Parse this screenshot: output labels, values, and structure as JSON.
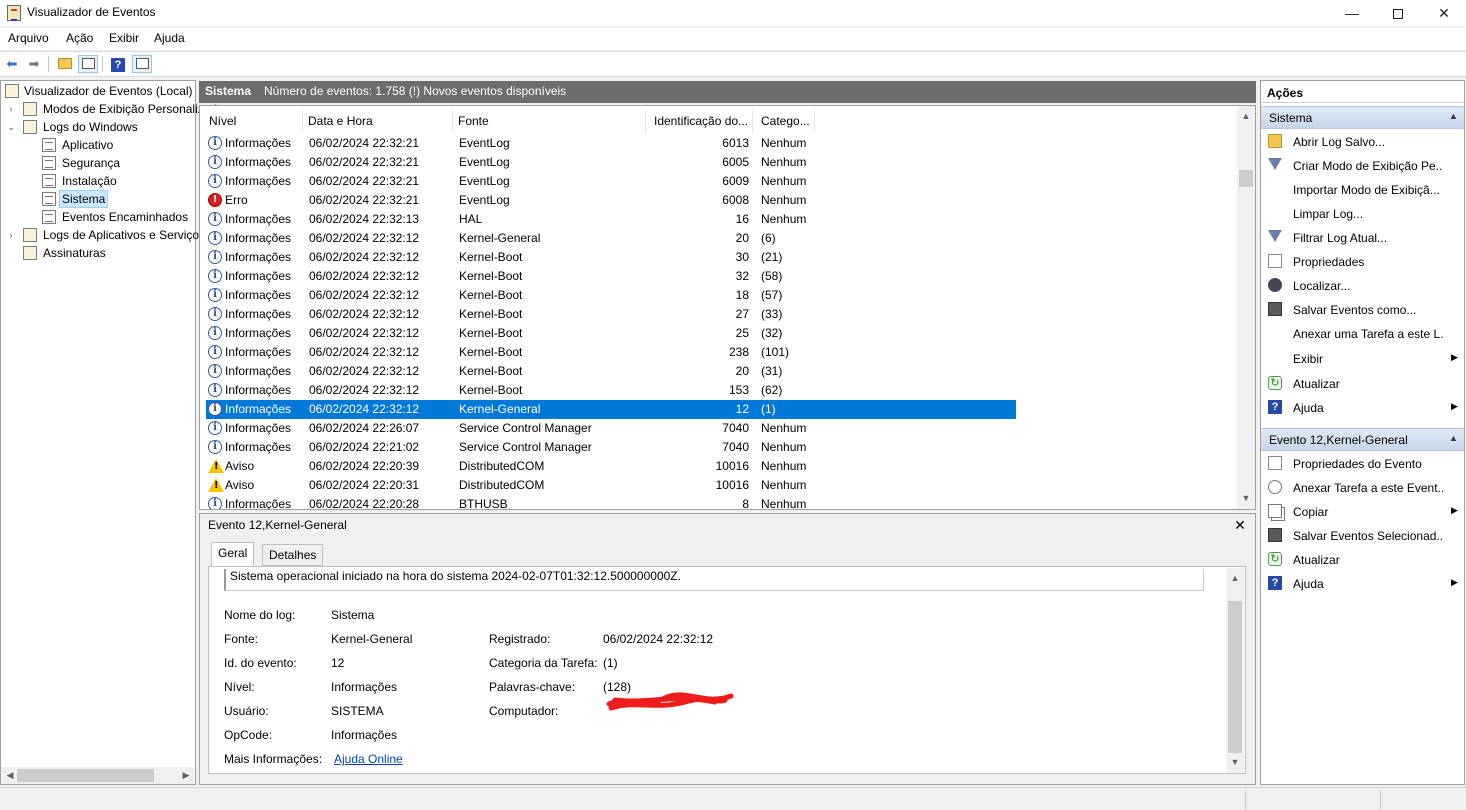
{
  "window": {
    "title": "Visualizador de Eventos",
    "min": "—",
    "close": "✕"
  },
  "menu": [
    "Arquivo",
    "Ação",
    "Exibir",
    "Ajuda"
  ],
  "tree": {
    "items": [
      {
        "label": "Visualizador de Eventos (Local)"
      },
      {
        "label": "Modos de Exibição Personalizados"
      },
      {
        "label": "Logs do Windows"
      },
      {
        "label": "Aplicativo"
      },
      {
        "label": "Segurança"
      },
      {
        "label": "Instalação"
      },
      {
        "label": "Sistema"
      },
      {
        "label": "Eventos Encaminhados"
      },
      {
        "label": "Logs de Aplicativos e Serviços"
      },
      {
        "label": "Assinaturas"
      }
    ]
  },
  "center": {
    "title": "Sistema",
    "subtitle": "Número de eventos: 1.758 (!) Novos eventos disponíveis"
  },
  "grid": {
    "columns": [
      "Nível",
      "Data e Hora",
      "Fonte",
      "Identificação do...",
      "Catego..."
    ],
    "rows": [
      {
        "icon": "info-icon",
        "level": "Informações",
        "date": "06/02/2024 22:32:21",
        "source": "EventLog",
        "id": "6013",
        "cat": "Nenhum"
      },
      {
        "icon": "info-icon",
        "level": "Informações",
        "date": "06/02/2024 22:32:21",
        "source": "EventLog",
        "id": "6005",
        "cat": "Nenhum"
      },
      {
        "icon": "info-icon",
        "level": "Informações",
        "date": "06/02/2024 22:32:21",
        "source": "EventLog",
        "id": "6009",
        "cat": "Nenhum"
      },
      {
        "icon": "error-icon",
        "level": "Erro",
        "date": "06/02/2024 22:32:21",
        "source": "EventLog",
        "id": "6008",
        "cat": "Nenhum"
      },
      {
        "icon": "info-icon",
        "level": "Informações",
        "date": "06/02/2024 22:32:13",
        "source": "HAL",
        "id": "16",
        "cat": "Nenhum"
      },
      {
        "icon": "info-icon",
        "level": "Informações",
        "date": "06/02/2024 22:32:12",
        "source": "Kernel-General",
        "id": "20",
        "cat": "(6)"
      },
      {
        "icon": "info-icon",
        "level": "Informações",
        "date": "06/02/2024 22:32:12",
        "source": "Kernel-Boot",
        "id": "30",
        "cat": "(21)"
      },
      {
        "icon": "info-icon",
        "level": "Informações",
        "date": "06/02/2024 22:32:12",
        "source": "Kernel-Boot",
        "id": "32",
        "cat": "(58)"
      },
      {
        "icon": "info-icon",
        "level": "Informações",
        "date": "06/02/2024 22:32:12",
        "source": "Kernel-Boot",
        "id": "18",
        "cat": "(57)"
      },
      {
        "icon": "info-icon",
        "level": "Informações",
        "date": "06/02/2024 22:32:12",
        "source": "Kernel-Boot",
        "id": "27",
        "cat": "(33)"
      },
      {
        "icon": "info-icon",
        "level": "Informações",
        "date": "06/02/2024 22:32:12",
        "source": "Kernel-Boot",
        "id": "25",
        "cat": "(32)"
      },
      {
        "icon": "info-icon",
        "level": "Informações",
        "date": "06/02/2024 22:32:12",
        "source": "Kernel-Boot",
        "id": "238",
        "cat": "(101)"
      },
      {
        "icon": "info-icon",
        "level": "Informações",
        "date": "06/02/2024 22:32:12",
        "source": "Kernel-Boot",
        "id": "20",
        "cat": "(31)"
      },
      {
        "icon": "info-icon",
        "level": "Informações",
        "date": "06/02/2024 22:32:12",
        "source": "Kernel-Boot",
        "id": "153",
        "cat": "(62)"
      },
      {
        "icon": "info-icon",
        "level": "Informações",
        "date": "06/02/2024 22:32:12",
        "source": "Kernel-General",
        "id": "12",
        "cat": "(1)",
        "selected": true
      },
      {
        "icon": "info-icon",
        "level": "Informações",
        "date": "06/02/2024 22:26:07",
        "source": "Service Control Manager",
        "id": "7040",
        "cat": "Nenhum"
      },
      {
        "icon": "info-icon",
        "level": "Informações",
        "date": "06/02/2024 22:21:02",
        "source": "Service Control Manager",
        "id": "7040",
        "cat": "Nenhum"
      },
      {
        "icon": "warning-icon",
        "level": "Aviso",
        "date": "06/02/2024 22:20:39",
        "source": "DistributedCOM",
        "id": "10016",
        "cat": "Nenhum"
      },
      {
        "icon": "warning-icon",
        "level": "Aviso",
        "date": "06/02/2024 22:20:31",
        "source": "DistributedCOM",
        "id": "10016",
        "cat": "Nenhum"
      },
      {
        "icon": "info-icon",
        "level": "Informações",
        "date": "06/02/2024 22:20:28",
        "source": "BTHUSB",
        "id": "8",
        "cat": "Nenhum"
      }
    ]
  },
  "detail": {
    "title": "Evento 12,Kernel-General",
    "close": "✕",
    "tabs": [
      "Geral",
      "Detalhes"
    ],
    "description": "Sistema operacional iniciado na hora do sistema 2024-02-07T01:32:12.500000000Z.",
    "fields": {
      "log_name_label": "Nome do log:",
      "log_name": "Sistema",
      "source_label": "Fonte:",
      "source": "Kernel-General",
      "recorded_label": "Registrado:",
      "recorded": "06/02/2024 22:32:12",
      "event_id_label": "Id. do evento:",
      "event_id": "12",
      "task_cat_label": "Categoria da Tarefa:",
      "task_cat": "(1)",
      "level_label": "Nível:",
      "level": "Informações",
      "keywords_label": "Palavras-chave:",
      "keywords": "(128)",
      "user_label": "Usuário:",
      "user": "SISTEMA",
      "computer_label": "Computador:",
      "opcode_label": "OpCode:",
      "opcode": "Informações",
      "more_info_label": "Mais Informações:",
      "more_info_link": "Ajuda Online"
    }
  },
  "actions": {
    "title": "Ações",
    "section1": {
      "title": "Sistema",
      "items": [
        {
          "label": "Abrir Log Salvo...",
          "icon": "open-folder-icon"
        },
        {
          "label": "Criar Modo de Exibição Pe...",
          "icon": "filter-icon"
        },
        {
          "label": "Importar Modo de Exibiçã...",
          "icon": ""
        },
        {
          "label": "Limpar Log...",
          "icon": ""
        },
        {
          "label": "Filtrar Log Atual...",
          "icon": "filter-icon"
        },
        {
          "label": "Propriedades",
          "icon": "properties-icon"
        },
        {
          "label": "Localizar...",
          "icon": "find-icon"
        },
        {
          "label": "Salvar Eventos como...",
          "icon": "save-icon"
        },
        {
          "label": "Anexar uma Tarefa a este L...",
          "icon": ""
        },
        {
          "label": "Exibir",
          "icon": "",
          "submenu": true
        },
        {
          "label": "Atualizar",
          "icon": "refresh-icon"
        },
        {
          "label": "Ajuda",
          "icon": "help-icon",
          "submenu": true
        }
      ]
    },
    "section2": {
      "title": "Evento 12,Kernel-General",
      "items": [
        {
          "label": "Propriedades do Evento",
          "icon": "properties-icon"
        },
        {
          "label": "Anexar Tarefa a este Event...",
          "icon": "task-clock-icon"
        },
        {
          "label": "Copiar",
          "icon": "copy-icon",
          "submenu": true
        },
        {
          "label": "Salvar Eventos Selecionad...",
          "icon": "save-icon"
        },
        {
          "label": "Atualizar",
          "icon": "refresh-icon"
        },
        {
          "label": "Ajuda",
          "icon": "help-icon",
          "submenu": true
        }
      ]
    }
  }
}
